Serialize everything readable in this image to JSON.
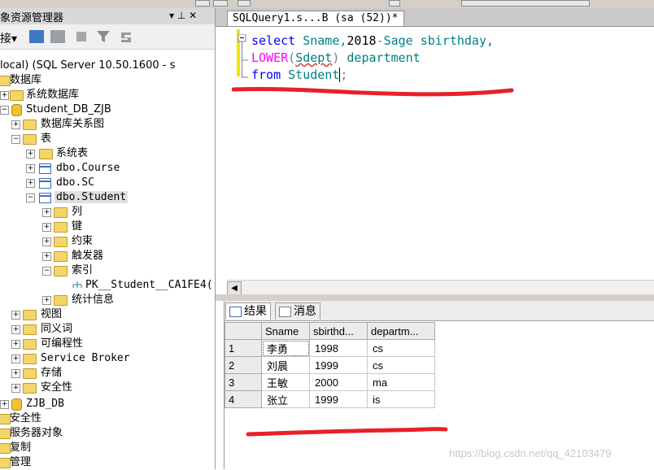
{
  "explorer": {
    "title": "象资源管理器",
    "pin_glyph": "▾ ⊥ ✕",
    "toolbar_label": "接▾",
    "server": "local) (SQL Server 10.50.1600 - s",
    "tree": [
      {
        "label": "数据库",
        "level": "db-root"
      },
      {
        "label": "系统数据库"
      },
      {
        "label": "Student_DB_ZJB"
      },
      {
        "label": "数据库关系图"
      },
      {
        "label": "表"
      },
      {
        "label": "系统表"
      },
      {
        "label": "dbo.Course"
      },
      {
        "label": "dbo.SC"
      },
      {
        "label": "dbo.Student"
      },
      {
        "label": "列"
      },
      {
        "label": "键"
      },
      {
        "label": "约束"
      },
      {
        "label": "触发器"
      },
      {
        "label": "索引"
      },
      {
        "label": "PK__Student__CA1FE4("
      },
      {
        "label": "统计信息"
      },
      {
        "label": "视图"
      },
      {
        "label": "同义词"
      },
      {
        "label": "可编程性"
      },
      {
        "label": "Service Broker"
      },
      {
        "label": "存储"
      },
      {
        "label": "安全性"
      },
      {
        "label": "ZJB_DB"
      },
      {
        "label": "安全性"
      },
      {
        "label": "服务器对象"
      },
      {
        "label": "复制"
      },
      {
        "label": "管理"
      }
    ]
  },
  "editor": {
    "tab_title": "SQLQuery1.s...B (sa (52))*",
    "code": {
      "l1_kw": "select",
      "l1_rest_a": " Sname,",
      "l1_num": "2018",
      "l1_op": "-",
      "l1_rest_b": "Sage sbirthday,",
      "l2_fn": "LOWER",
      "l2_p1": "(",
      "l2_arg": "Sdept",
      "l2_p2": ")",
      "l2_rest": " department",
      "l3_kw": "from",
      "l3_rest": " Student",
      "l3_end": ";"
    }
  },
  "results": {
    "tab_results": "结果",
    "tab_messages": "消息",
    "columns": [
      "Sname",
      "sbirthd...",
      "departm..."
    ],
    "rows": [
      {
        "n": "1",
        "cells": [
          "李勇",
          "1998",
          "cs"
        ]
      },
      {
        "n": "2",
        "cells": [
          "刘晨",
          "1999",
          "cs"
        ]
      },
      {
        "n": "3",
        "cells": [
          "王敏",
          "2000",
          "ma"
        ]
      },
      {
        "n": "4",
        "cells": [
          "张立",
          "1999",
          "is"
        ]
      }
    ]
  },
  "watermark": "https://blog.csdn.net/qq_42103479",
  "colors": {
    "keyword": "#0000ff",
    "function": "#ff00ff",
    "identifier": "#008080",
    "annotation": "#e8202a"
  }
}
